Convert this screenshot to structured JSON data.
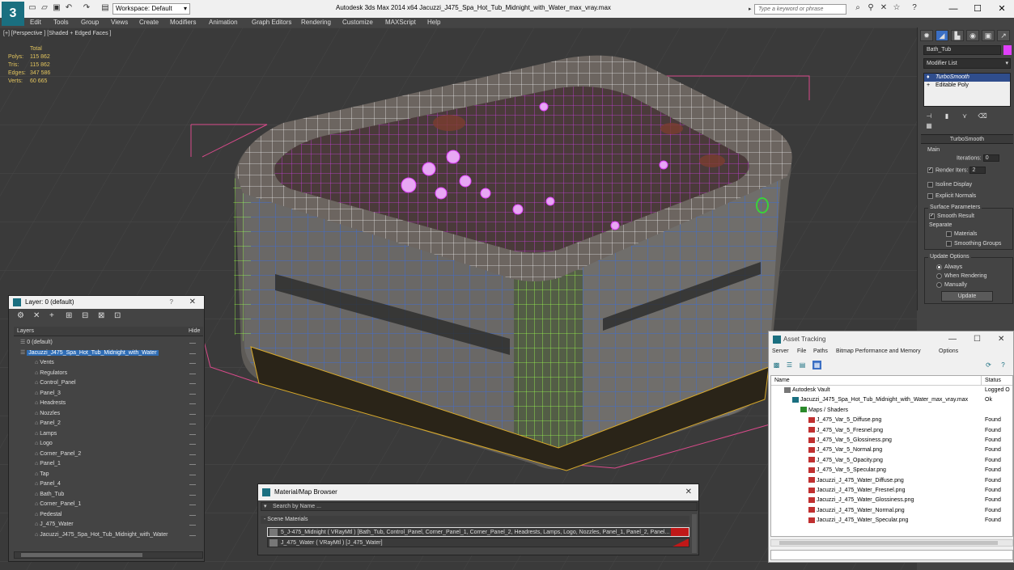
{
  "titlebar": {
    "app_logo": "3",
    "workspace_label": "Workspace: Default",
    "title": "Autodesk 3ds Max  2014 x64       Jacuzzi_J475_Spa_Hot_Tub_Midnight_with_Water_max_vray.max",
    "search_placeholder": "Type a keyword or phrase",
    "icons": [
      "new-icon",
      "open-icon",
      "save-icon",
      "undo-icon",
      "redo-icon",
      "project-icon",
      "binoculars-icon",
      "exchange-icon",
      "star-icon",
      "help-icon"
    ],
    "window_buttons": {
      "minimize": "—",
      "maximize": "☐",
      "close": "✕"
    }
  },
  "menubar": {
    "items": [
      "Edit",
      "Tools",
      "Group",
      "Views",
      "Create",
      "Modifiers",
      "Animation",
      "Graph Editors",
      "Rendering",
      "Customize",
      "MAXScript",
      "Help"
    ]
  },
  "viewport": {
    "label": "[+] [Perspective ] [Shaded + Edged Faces ]",
    "stats": {
      "header": "Total",
      "rows": [
        {
          "label": "Polys:",
          "value": "115 862"
        },
        {
          "label": "Tris:",
          "value": "115 862"
        },
        {
          "label": "Edges:",
          "value": "347 586"
        },
        {
          "label": "Verts:",
          "value": "60 665"
        }
      ]
    },
    "colors": {
      "wire_white": "#f2f2f2",
      "wire_magenta": "#e040fb",
      "wire_green": "#9cff4a",
      "wire_blue": "#3c6ed8",
      "bbox": "#d84a8a"
    }
  },
  "command_panel": {
    "tabs": [
      "create-tab",
      "modify-tab",
      "hierarchy-tab",
      "motion-tab",
      "display-tab",
      "utilities-tab"
    ],
    "object_name": "Bath_Tub",
    "object_color": "#e040fb",
    "modifier_list": "Modifier List",
    "stack": [
      "TurboSmooth",
      "Editable Poly"
    ],
    "turbosmooth": {
      "title": "TurboSmooth",
      "main": "Main",
      "iterations_label": "Iterations:",
      "iterations_value": "0",
      "render_iters_label": "Render Iters:",
      "render_iters_value": "2",
      "render_iters_checked": true,
      "isoline": "Isoline Display",
      "explicit": "Explicit Normals",
      "surface_title": "Surface Parameters",
      "smooth_result": "Smooth Result",
      "separate": "Separate",
      "materials": "Materials",
      "smoothing_groups": "Smoothing Groups",
      "update_title": "Update Options",
      "always": "Always",
      "when_rendering": "When Rendering",
      "manually": "Manually",
      "update_btn": "Update"
    }
  },
  "layer_panel": {
    "title": "Layer: 0 (default)",
    "help": "?",
    "close": "✕",
    "col_layers": "Layers",
    "col_hide": "Hide",
    "rows": [
      {
        "name": "0 (default)",
        "indent": 0,
        "type": "layer"
      },
      {
        "name": "Jacuzzi_J475_Spa_Hot_Tub_Midnight_with_Water",
        "indent": 0,
        "type": "layer-selected"
      },
      {
        "name": "Vents",
        "indent": 1,
        "type": "object"
      },
      {
        "name": "Regulators",
        "indent": 1,
        "type": "object"
      },
      {
        "name": "Control_Panel",
        "indent": 1,
        "type": "object"
      },
      {
        "name": "Panel_3",
        "indent": 1,
        "type": "object"
      },
      {
        "name": "Headrests",
        "indent": 1,
        "type": "object"
      },
      {
        "name": "Nozzles",
        "indent": 1,
        "type": "object"
      },
      {
        "name": "Panel_2",
        "indent": 1,
        "type": "object"
      },
      {
        "name": "Lamps",
        "indent": 1,
        "type": "object"
      },
      {
        "name": "Logo",
        "indent": 1,
        "type": "object"
      },
      {
        "name": "Corner_Panel_2",
        "indent": 1,
        "type": "object"
      },
      {
        "name": "Panel_1",
        "indent": 1,
        "type": "object"
      },
      {
        "name": "Tap",
        "indent": 1,
        "type": "object"
      },
      {
        "name": "Panel_4",
        "indent": 1,
        "type": "object"
      },
      {
        "name": "Bath_Tub",
        "indent": 1,
        "type": "object"
      },
      {
        "name": "Corner_Panel_1",
        "indent": 1,
        "type": "object"
      },
      {
        "name": "Pedestal",
        "indent": 1,
        "type": "object"
      },
      {
        "name": "J_475_Water",
        "indent": 1,
        "type": "object"
      },
      {
        "name": "Jacuzzi_J475_Spa_Hot_Tub_Midnight_with_Water",
        "indent": 1,
        "type": "object"
      }
    ]
  },
  "material_browser": {
    "title": "Material/Map Browser",
    "close": "✕",
    "search_placeholder": "Search by Name ...",
    "section": "- Scene Materials",
    "materials": [
      "5_J-475_Midnight  ( VRayMtl )  [Bath_Tub, Control_Panel, Corner_Panel_1, Corner_Panel_2, Headrests, Lamps, Logo, Nozzles, Panel_1, Panel_2, Panel...",
      "J_475_Water  ( VRayMtl )  [J_475_Water]"
    ]
  },
  "asset_tracking": {
    "title": "Asset Tracking",
    "menu": [
      "Server",
      "File",
      "Paths",
      "Bitmap Performance and Memory",
      "Options"
    ],
    "col_name": "Name",
    "col_status": "Status",
    "rows": [
      {
        "name": "Autodesk Vault",
        "status": "Logged O",
        "indent": 1,
        "kind": "vault"
      },
      {
        "name": "Jacuzzi_J475_Spa_Hot_Tub_Midnight_with_Water_max_vray.max",
        "status": "Ok",
        "indent": 2,
        "kind": "max"
      },
      {
        "name": "Maps / Shaders",
        "status": "",
        "indent": 3,
        "kind": "folder"
      },
      {
        "name": "J_475_Var_5_Diffuse.png",
        "status": "Found",
        "indent": 4,
        "kind": "map"
      },
      {
        "name": "J_475_Var_5_Fresnel.png",
        "status": "Found",
        "indent": 4,
        "kind": "map"
      },
      {
        "name": "J_475_Var_5_Glossiness.png",
        "status": "Found",
        "indent": 4,
        "kind": "map"
      },
      {
        "name": "J_475_Var_5_Normal.png",
        "status": "Found",
        "indent": 4,
        "kind": "map"
      },
      {
        "name": "J_475_Var_5_Opacity.png",
        "status": "Found",
        "indent": 4,
        "kind": "map"
      },
      {
        "name": "J_475_Var_5_Specular.png",
        "status": "Found",
        "indent": 4,
        "kind": "map"
      },
      {
        "name": "Jacuzzi_J_475_Water_Diffuse.png",
        "status": "Found",
        "indent": 4,
        "kind": "map"
      },
      {
        "name": "Jacuzzi_J_475_Water_Fresnel.png",
        "status": "Found",
        "indent": 4,
        "kind": "map"
      },
      {
        "name": "Jacuzzi_J_475_Water_Glossiness.png",
        "status": "Found",
        "indent": 4,
        "kind": "map"
      },
      {
        "name": "Jacuzzi_J_475_Water_Normal.png",
        "status": "Found",
        "indent": 4,
        "kind": "map"
      },
      {
        "name": "Jacuzzi_J_475_Water_Specular.png",
        "status": "Found",
        "indent": 4,
        "kind": "map"
      }
    ]
  }
}
